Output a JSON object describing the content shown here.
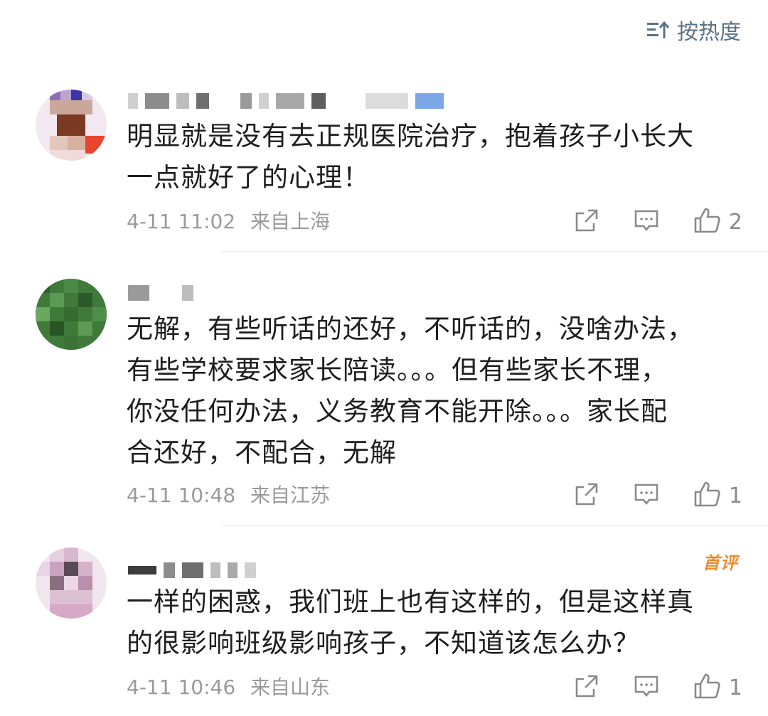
{
  "sort": {
    "label": "按热度",
    "icon": "sort-up-icon"
  },
  "comments": [
    {
      "content": "明显就是没有去正规医院治疗，抱着孩子小长大\n一点就好了的心理！",
      "time": "4-11 11:02",
      "location": "来自上海",
      "likes": "2"
    },
    {
      "content": "无解，有些听话的还好，不听话的，没啥办法，\n有些学校要求家长陪读。。。但有些家长不理，\n你没任何办法，义务教育不能开除。。。家长配\n合还好，不配合，无解",
      "time": "4-11 10:48",
      "location": "来自江苏",
      "likes": "1"
    },
    {
      "badge": "首评",
      "content": "一样的困惑，我们班上也有这样的，但是这样真\n的很影响班级影响孩子，不知道该怎么办？",
      "time": "4-11 10:46",
      "location": "来自山东",
      "likes": "1"
    }
  ],
  "icons": {
    "share": "share-icon",
    "reply": "reply-icon",
    "like": "thumbs-up-icon"
  },
  "colors": {
    "link": "#5a7287",
    "meta": "#9a9a9a",
    "badge": "#ef8b2a"
  }
}
